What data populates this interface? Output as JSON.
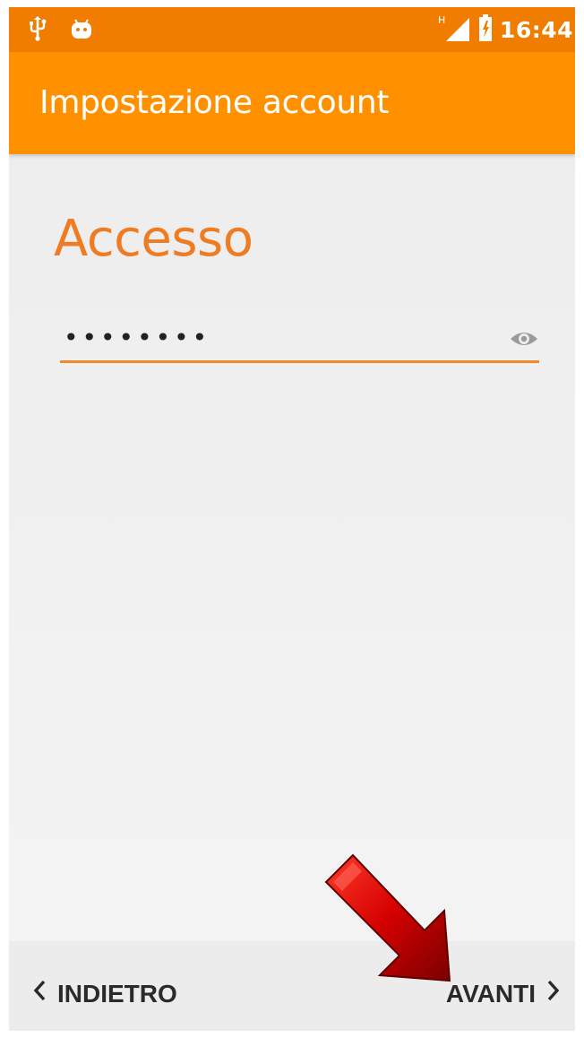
{
  "status_bar": {
    "time": "16:44",
    "network_type": "H",
    "left_icons": [
      "usb-icon",
      "android-icon"
    ],
    "right_icons": [
      "signal-icon",
      "battery-icon"
    ],
    "color": "#f07d00"
  },
  "app_bar": {
    "title": "Impostazione account",
    "color": "#ff9100"
  },
  "main": {
    "heading": "Accesso",
    "password": {
      "value": "••••••••",
      "toggle_icon": "eye-icon"
    },
    "accent_color": "#ef7b22"
  },
  "navigation": {
    "back_label": "INDIETRO",
    "next_label": "AVANTI",
    "back_icon": "chevron-left-icon",
    "next_icon": "chevron-right-icon"
  },
  "annotation": {
    "icon": "red-arrow-icon",
    "color": "#c40000"
  }
}
